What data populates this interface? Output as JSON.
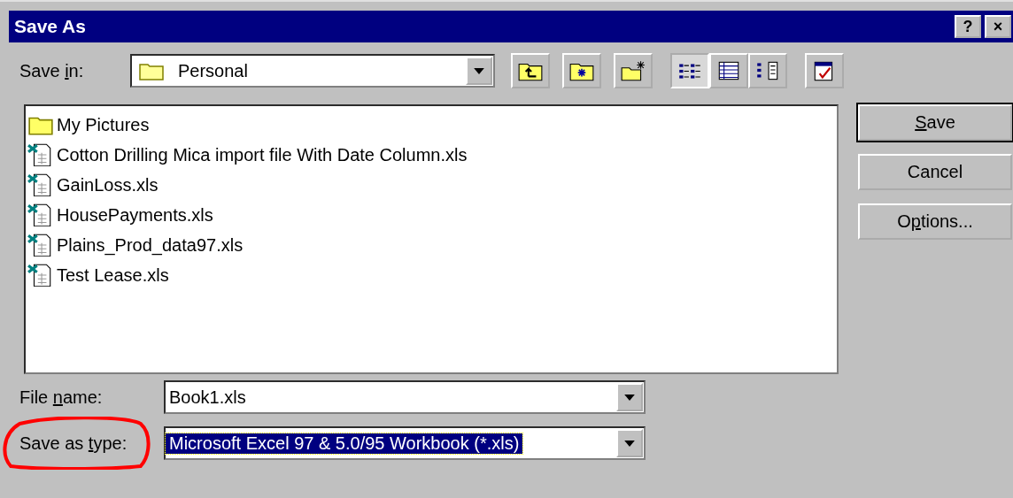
{
  "window": {
    "title": "Save As",
    "title_buttons": [
      "?",
      "×"
    ]
  },
  "save_in": {
    "label": {
      "pre": "Save ",
      "key": "i",
      "post": "n:"
    },
    "value": "Personal"
  },
  "toolbar": [
    {
      "kind": "up-folder"
    },
    {
      "kind": "star-folder"
    },
    {
      "kind": "new-folder"
    },
    {
      "kind": "list-view",
      "selected": true
    },
    {
      "kind": "details-view",
      "selected": false
    },
    {
      "kind": "properties-view",
      "selected": false
    },
    {
      "kind": "tools"
    }
  ],
  "files": [
    {
      "kind": "folder",
      "name": "My Pictures"
    },
    {
      "kind": "excel",
      "name": "Cotton Drilling Mica import file With Date Column.xls"
    },
    {
      "kind": "excel",
      "name": "GainLoss.xls"
    },
    {
      "kind": "excel",
      "name": "HousePayments.xls"
    },
    {
      "kind": "excel",
      "name": "Plains_Prod_data97.xls"
    },
    {
      "kind": "excel",
      "name": "Test Lease.xls"
    }
  ],
  "file_name": {
    "label": {
      "pre": "File ",
      "key": "n",
      "post": "ame:"
    },
    "value": "Book1.xls",
    "selected": false
  },
  "save_as_type": {
    "label": {
      "pre": "Save as ",
      "key": "t",
      "post": "ype:"
    },
    "value": "Microsoft Excel 97 & 5.0/95 Workbook (*.xls)",
    "selected": true,
    "highlighted": true
  },
  "buttons": [
    {
      "label": {
        "key": "S",
        "post": "ave"
      },
      "default": true
    },
    {
      "label": {
        "pre": "Cancel"
      },
      "default": false
    },
    {
      "label": {
        "pre": "O",
        "key": "p",
        "post": "tions..."
      },
      "default": false
    }
  ]
}
